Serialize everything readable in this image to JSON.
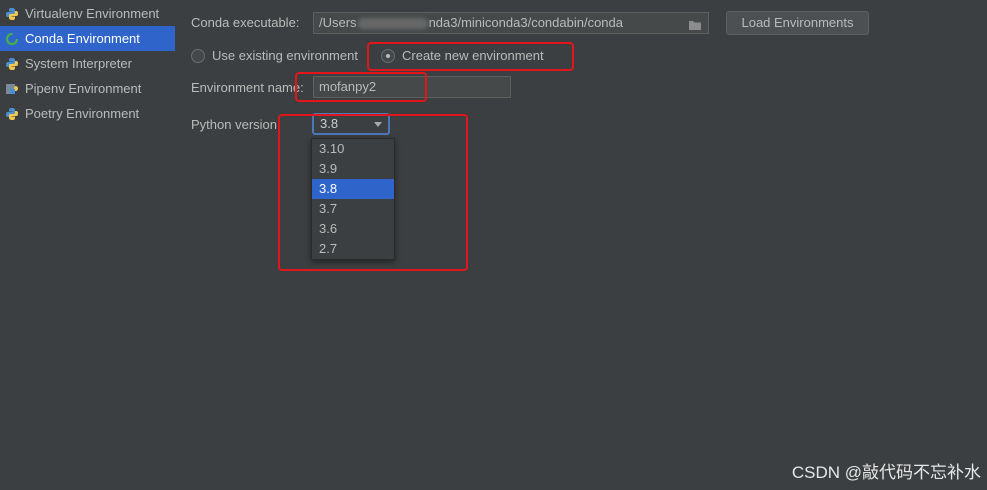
{
  "sidebar": {
    "items": [
      {
        "label": "Virtualenv Environment",
        "icon": "python-icon",
        "selected": false
      },
      {
        "label": "Conda Environment",
        "icon": "conda-icon",
        "selected": true
      },
      {
        "label": "System Interpreter",
        "icon": "python-icon",
        "selected": false
      },
      {
        "label": "Pipenv Environment",
        "icon": "pipenv-icon",
        "selected": false
      },
      {
        "label": "Poetry Environment",
        "icon": "python-icon",
        "selected": false
      }
    ]
  },
  "form": {
    "conda_executable_label": "Conda executable:",
    "conda_executable_prefix": "/Users",
    "conda_executable_suffix": "nda3/miniconda3/condabin/conda",
    "load_environments_button": "Load Environments",
    "use_existing_label": "Use existing environment",
    "create_new_label": "Create new environment",
    "selected_mode": "create_new",
    "environment_name_label": "Environment name:",
    "environment_name_value": "mofanpy2",
    "python_version_label": "Python version:",
    "python_version_value": "3.8",
    "python_version_options": [
      "3.10",
      "3.9",
      "3.8",
      "3.7",
      "3.6",
      "2.7"
    ],
    "python_version_selected_index": 2
  },
  "watermark": "CSDN @敲代码不忘补水",
  "colors": {
    "background": "#3c3f41",
    "selection": "#2f65ca",
    "highlight_box": "#e0161a",
    "text": "#bbbbbb"
  }
}
